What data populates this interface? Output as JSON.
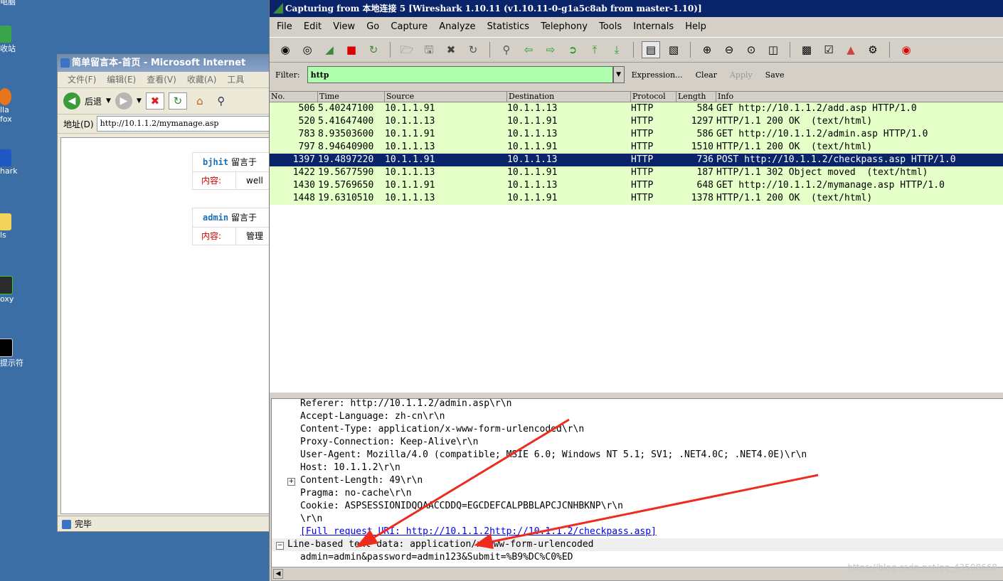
{
  "desktop": {
    "icons": [
      {
        "label": "电脑",
        "icon": "computer-icon"
      },
      {
        "label": "收站",
        "icon": "recycle-bin-icon"
      },
      {
        "label": "lla fox",
        "icon": "firefox-icon"
      },
      {
        "label": "hark",
        "icon": "wireshark-icon"
      },
      {
        "label": "ls",
        "icon": "folder-icon"
      },
      {
        "label": "oxy",
        "icon": "proxy-icon"
      },
      {
        "label": "提示符",
        "icon": "command-prompt-icon"
      }
    ]
  },
  "ie": {
    "title": "简单留言本-首页 - Microsoft Internet",
    "menu": [
      "文件(F)",
      "编辑(E)",
      "查看(V)",
      "收藏(A)",
      "工具"
    ],
    "back_label": "后退",
    "address_label": "地址(D)",
    "address": "http://10.1.1.2/mymanage.asp",
    "messages": [
      {
        "user": "bjhit",
        "suffix": "留言于",
        "content_label": "内容:",
        "content": "well"
      },
      {
        "user": "admin",
        "suffix": "留言于",
        "content_label": "内容:",
        "content": "管理"
      }
    ],
    "status": "完毕"
  },
  "wireshark": {
    "title": "Capturing from 本地连接 5    [Wireshark 1.10.11  (v1.10.11-0-g1a5c8ab from master-1.10)]",
    "menu": [
      "File",
      "Edit",
      "View",
      "Go",
      "Capture",
      "Analyze",
      "Statistics",
      "Telephony",
      "Tools",
      "Internals",
      "Help"
    ],
    "filter": {
      "label": "Filter:",
      "value": "http",
      "expression": "Expression...",
      "clear": "Clear",
      "apply": "Apply",
      "save": "Save"
    },
    "columns": [
      "No.",
      "Time",
      "Source",
      "Destination",
      "Protocol",
      "Length",
      "Info"
    ],
    "packets": [
      {
        "no": "506",
        "time": "5.40247100",
        "src": "10.1.1.91",
        "dst": "10.1.1.13",
        "proto": "HTTP",
        "len": "584",
        "info": "GET http://10.1.1.2/add.asp HTTP/1.0"
      },
      {
        "no": "520",
        "time": "5.41647400",
        "src": "10.1.1.13",
        "dst": "10.1.1.91",
        "proto": "HTTP",
        "len": "1297",
        "info": "HTTP/1.1 200 OK  (text/html)"
      },
      {
        "no": "783",
        "time": "8.93503600",
        "src": "10.1.1.91",
        "dst": "10.1.1.13",
        "proto": "HTTP",
        "len": "586",
        "info": "GET http://10.1.1.2/admin.asp HTTP/1.0"
      },
      {
        "no": "797",
        "time": "8.94640900",
        "src": "10.1.1.13",
        "dst": "10.1.1.91",
        "proto": "HTTP",
        "len": "1510",
        "info": "HTTP/1.1 200 OK  (text/html)"
      },
      {
        "no": "1397",
        "time": "19.4897220",
        "src": "10.1.1.91",
        "dst": "10.1.1.13",
        "proto": "HTTP",
        "len": "736",
        "info": "POST http://10.1.1.2/checkpass.asp HTTP/1.0",
        "selected": true
      },
      {
        "no": "1422",
        "time": "19.5677590",
        "src": "10.1.1.13",
        "dst": "10.1.1.91",
        "proto": "HTTP",
        "len": "187",
        "info": "HTTP/1.1 302 Object moved  (text/html)"
      },
      {
        "no": "1430",
        "time": "19.5769650",
        "src": "10.1.1.91",
        "dst": "10.1.1.13",
        "proto": "HTTP",
        "len": "648",
        "info": "GET http://10.1.1.2/mymanage.asp HTTP/1.0"
      },
      {
        "no": "1448",
        "time": "19.6310510",
        "src": "10.1.1.13",
        "dst": "10.1.1.91",
        "proto": "HTTP",
        "len": "1378",
        "info": "HTTP/1.1 200 OK  (text/html)"
      }
    ],
    "details": [
      "Referer: http://10.1.1.2/admin.asp\\r\\n",
      "Accept-Language: zh-cn\\r\\n",
      "Content-Type: application/x-www-form-urlencoded\\r\\n",
      "Proxy-Connection: Keep-Alive\\r\\n",
      "User-Agent: Mozilla/4.0 (compatible; MSIE 6.0; Windows NT 5.1; SV1; .NET4.0C; .NET4.0E)\\r\\n",
      "Host: 10.1.1.2\\r\\n",
      "Content-Length: 49\\r\\n",
      "Pragma: no-cache\\r\\n",
      "Cookie: ASPSESSIONIDQQAACCDDQ=EGCDEFCALPBBLAPCJCNHBKNP\\r\\n",
      "\\r\\n",
      "[Full request URI: http://10.1.1.2http://10.1.1.2/checkpass.asp]",
      "Line-based text data: application/x-www-form-urlencoded",
      "admin=admin&password=admin123&Submit=%B9%DC%C0%ED"
    ]
  },
  "watermark": "https://blog.csdn.net/qq_43508668",
  "colors": {
    "selected_row": "#0a246a",
    "http_row": "#e4ffc7",
    "filter_valid": "#afffaf",
    "annotation_arrow": "#ee2b1e"
  }
}
